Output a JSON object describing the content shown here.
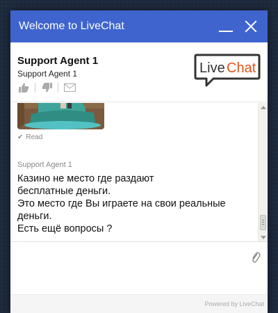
{
  "header": {
    "title": "Welcome to LiveChat",
    "minimize_icon": "minimize-icon",
    "close_icon": "close-icon",
    "color": "#3f64ce"
  },
  "agent": {
    "name": "Support Agent 1",
    "role": "Support Agent 1",
    "rating_icons": [
      "thumbs-up-icon",
      "thumbs-down-icon",
      "email-transcript-icon"
    ]
  },
  "logo": {
    "text": "LiveChat",
    "accent": "#e5531a"
  },
  "messages": {
    "image_status": "Read",
    "author": "Support Agent 1",
    "lines": [
      "Казино не место где раздают",
      "бесплатные деньги.",
      "Это место где Вы играете на свои реальные",
      "деньги.",
      "Есть ещё вопросы ?"
    ]
  },
  "input": {
    "value": "",
    "placeholder": "",
    "attach_icon": "paperclip-icon"
  },
  "footer": {
    "text": "Powered by LiveChat"
  }
}
